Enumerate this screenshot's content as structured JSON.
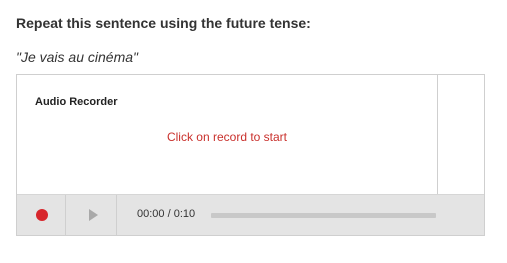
{
  "question": {
    "heading": "Repeat this sentence using the future tense:",
    "sentence": "\"Je vais au cinéma\""
  },
  "recorder": {
    "title": "Audio Recorder",
    "status": "Click on record to start",
    "time_display": "00:00 / 0:10",
    "progress": 0,
    "record_icon": "record-icon",
    "play_icon": "play-icon",
    "colors": {
      "record": "#d7262c",
      "status_text": "#c9302c",
      "controls_bg": "#e4e4e4"
    }
  }
}
